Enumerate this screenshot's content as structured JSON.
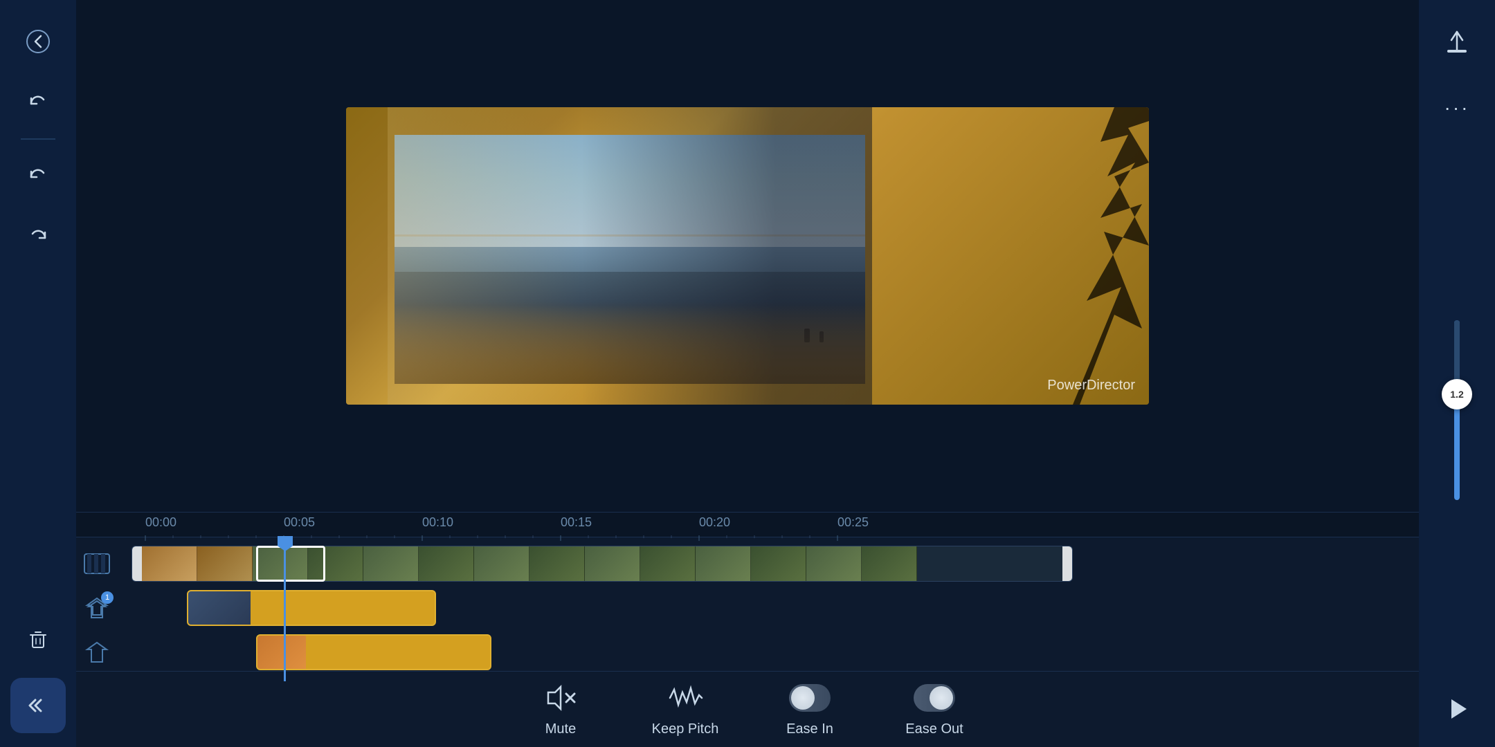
{
  "app": {
    "title": "PowerDirector",
    "watermark": "PowerDirector"
  },
  "sidebar": {
    "back_icon": "◀",
    "undo_icon": "↩",
    "undo2_icon": "↩",
    "redo_icon": "↪",
    "delete_icon": "🗑",
    "collapse_icon": "«"
  },
  "right_sidebar": {
    "export_icon": "⬆",
    "more_icon": "•••",
    "play_icon": "▶",
    "volume_value": "1.2"
  },
  "timeline": {
    "ruler": {
      "marks": [
        "00:00",
        "00:05",
        "00:10",
        "00:15",
        "00:20",
        "00:25"
      ]
    }
  },
  "toolbar": {
    "mute_label": "Mute",
    "keep_pitch_label": "Keep Pitch",
    "ease_in_label": "Ease In",
    "ease_out_label": "Ease Out"
  }
}
